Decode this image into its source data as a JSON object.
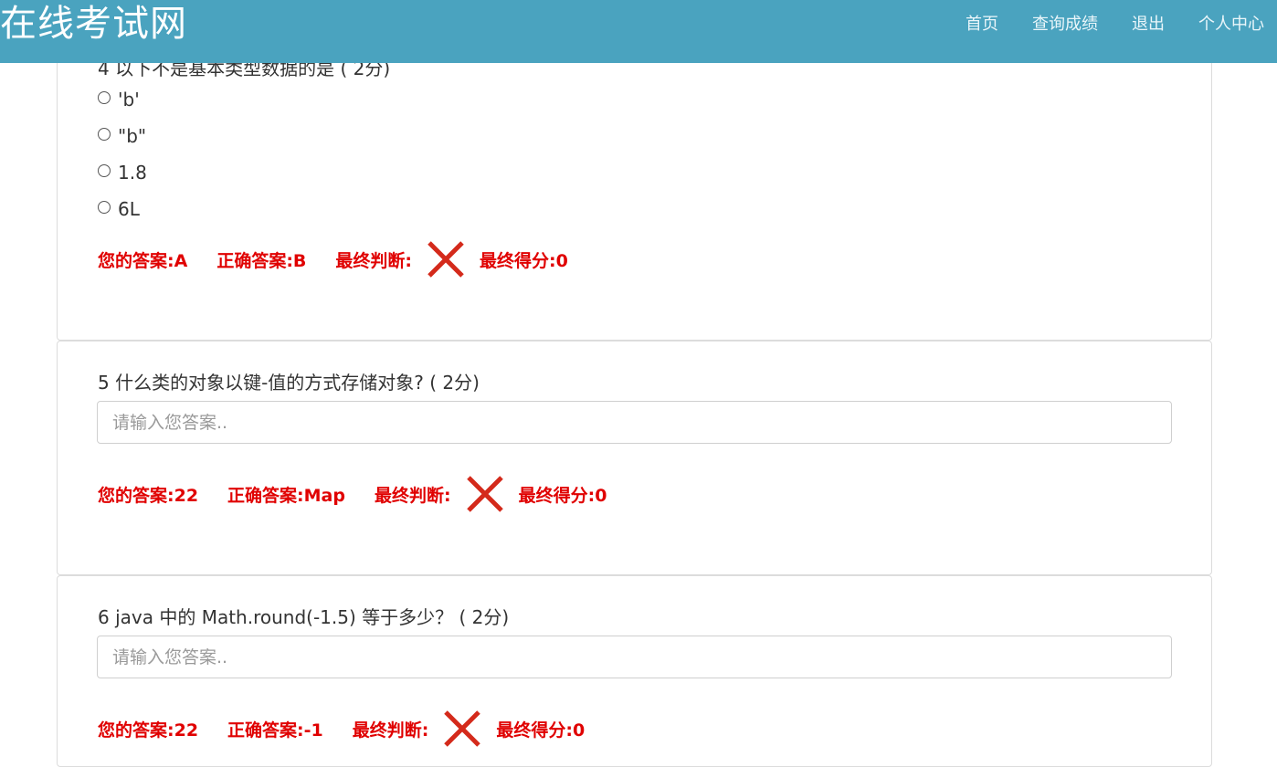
{
  "navbar": {
    "brand": "在线考试网",
    "links": [
      "首页",
      "查询成绩",
      "退出",
      "个人中心"
    ]
  },
  "questions": [
    {
      "title": "4 以下不是基本类型数据的是 ( 2分)",
      "options": [
        "'b'",
        "\"b\"",
        "1.8",
        "6L"
      ],
      "your_answer": "您的答案:A",
      "correct_answer": "正确答案:B",
      "judgement_label": "最终判断:",
      "score": "最终得分:0"
    },
    {
      "title": "5 什么类的对象以键-值的方式存储对象? ( 2分)",
      "input_placeholder": "请输入您答案..",
      "your_answer": "您的答案:22",
      "correct_answer": "正确答案:Map",
      "judgement_label": "最终判断:",
      "score": "最终得分:0"
    },
    {
      "title": "6 java 中的 Math.round(-1.5) 等于多少？ ( 2分)",
      "input_placeholder": "请输入您答案..",
      "your_answer": "您的答案:22",
      "correct_answer": "正确答案:-1",
      "judgement_label": "最终判断:",
      "score": "最终得分:0"
    }
  ],
  "colors": {
    "navbar": "#4aa3bf",
    "result_text": "#e00000",
    "wrong_mark": "#d42a1b"
  },
  "icons": {
    "wrong": "cross-icon",
    "radio": "radio-unchecked-icon"
  }
}
